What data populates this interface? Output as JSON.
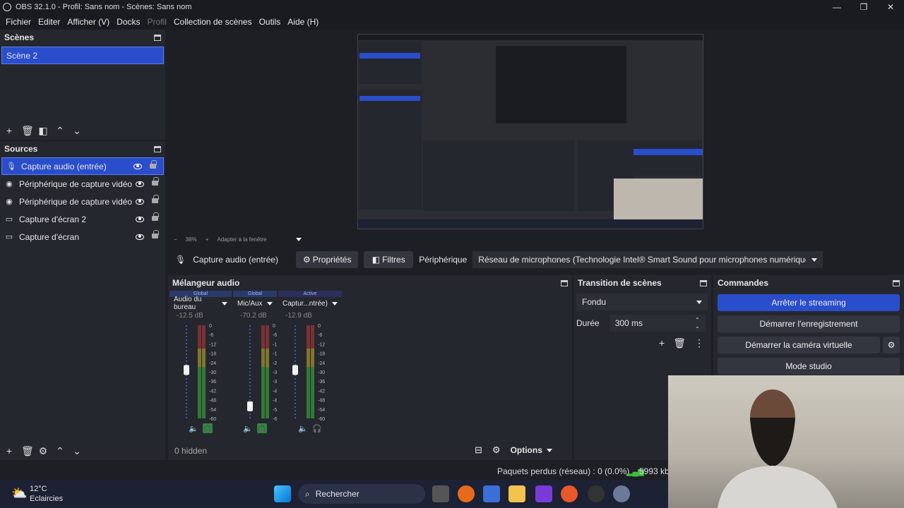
{
  "window": {
    "title": "OBS 32.1.0 - Profil: Sans nom - Scènes: Sans nom"
  },
  "menu": [
    "Fichier",
    "Editer",
    "Afficher (V)",
    "Docks",
    "Profil",
    "Collection de scènes",
    "Outils",
    "Aide (H)"
  ],
  "scenes": {
    "title": "Scènes",
    "items": [
      "Scène 2"
    ]
  },
  "sources": {
    "title": "Sources",
    "items": [
      {
        "label": "Capture audio (entrée)",
        "icon": "microphone-icon"
      },
      {
        "label": "Périphérique de capture vidéo",
        "icon": "camera-icon"
      },
      {
        "label": "Périphérique de capture vidéo",
        "icon": "camera-icon"
      },
      {
        "label": "Capture d'écran 2",
        "icon": "monitor-icon"
      },
      {
        "label": "Capture d'écran",
        "icon": "monitor-icon"
      }
    ]
  },
  "zoom": {
    "value": "38%",
    "fit": "Adapter à la fenêtre"
  },
  "source_bar": {
    "name": "Capture audio (entrée)",
    "properties": "Propriétés",
    "filters": "Filtres",
    "device_label": "Périphérique",
    "device_value": "Réseau de microphones (Technologie Intel® Smart Sound pour microphones numériques)"
  },
  "mixer": {
    "title": "Mélangeur audio",
    "channels": [
      {
        "tag": "Global",
        "name": "Audio du bureau",
        "db": "-12.5 dB",
        "level": 0.52
      },
      {
        "tag": "Global",
        "name": "Mic/Aux",
        "db": "-70.2 dB",
        "level": 0.13
      },
      {
        "tag": "Active",
        "name": "Captur...ntrée)",
        "db": "-12.9 dB",
        "level": 0.52
      }
    ],
    "scale": [
      "0",
      "-6",
      "-12",
      "-18",
      "-24",
      "-30",
      "-36",
      "-42",
      "-48",
      "-54",
      "-60"
    ],
    "hidden": "0 hidden",
    "options": "Options"
  },
  "transition": {
    "title": "Transition de scènes",
    "type": "Fondu",
    "duration_label": "Durée",
    "duration": "300 ms"
  },
  "commands": {
    "title": "Commandes",
    "stop_stream": "Arrêter le streaming",
    "start_record": "Démarrer l'enregistrement",
    "virtual_cam": "Démarrer la caméra virtuelle",
    "studio": "Mode studio"
  },
  "status": {
    "dropped": "Paquets perdus (réseau) : 0 (0.0%)",
    "bitrate": "5993 kb"
  },
  "taskbar": {
    "temp": "12°C",
    "weather": "Eclaircies",
    "search": "Rechercher"
  },
  "colors": {
    "accent": "#2a4ecb",
    "meter_green": "#3fbf3f",
    "meter_yellow": "#c8b82a",
    "meter_red": "#c23a3a"
  }
}
